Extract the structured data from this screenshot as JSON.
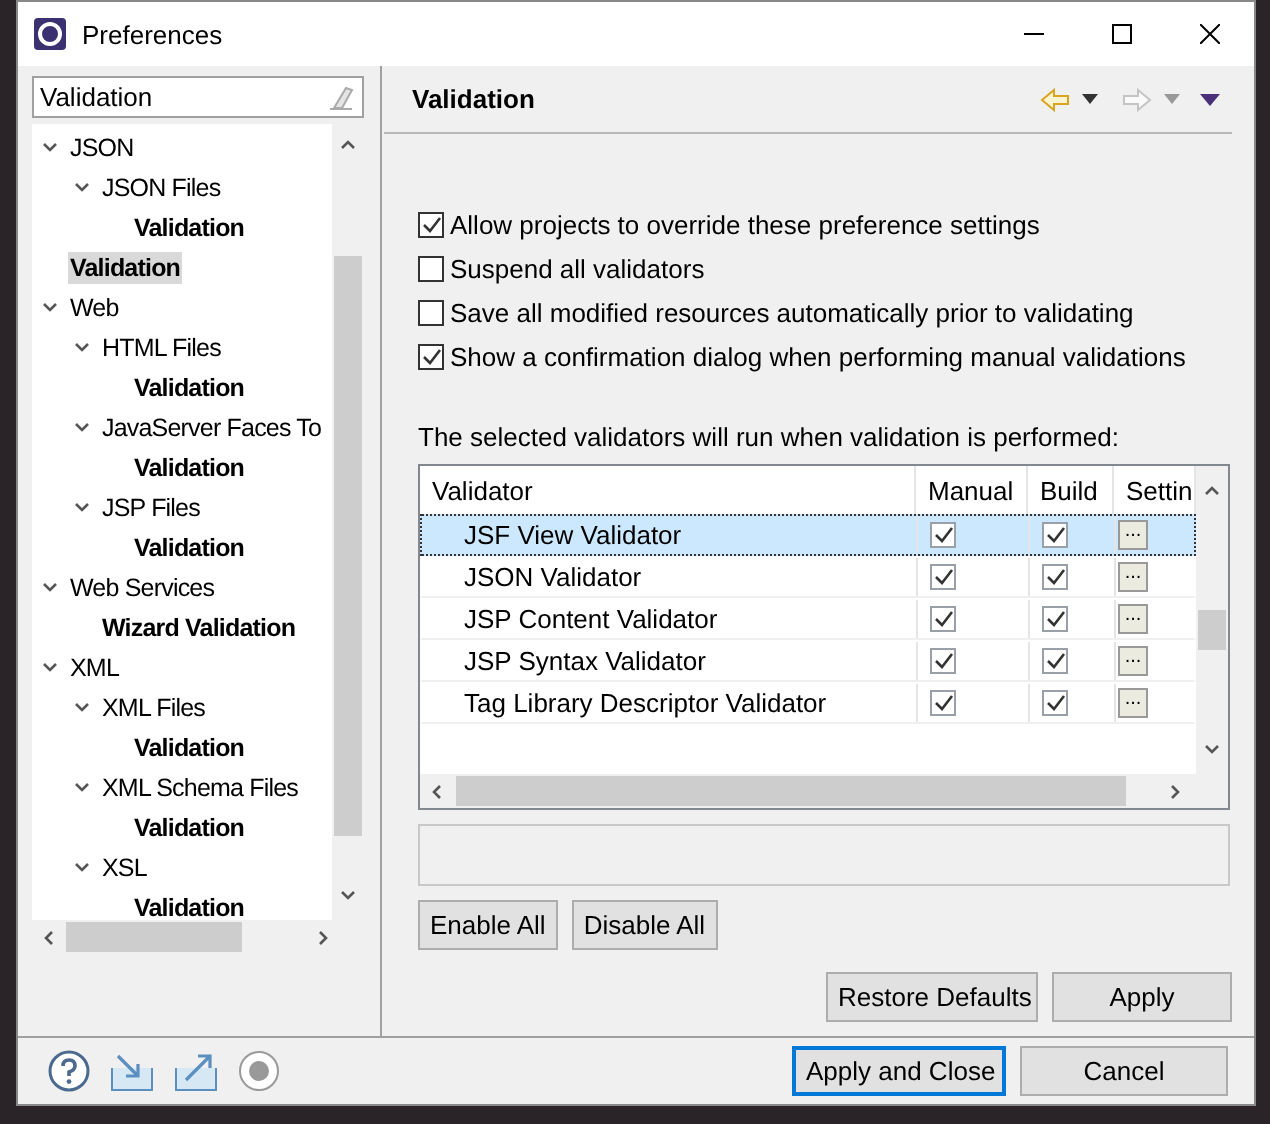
{
  "window": {
    "title": "Preferences"
  },
  "filter": {
    "value": "Validation"
  },
  "tree": [
    {
      "label": "JSON",
      "expanded": true,
      "selected": false,
      "children": [
        {
          "label": "JSON Files",
          "expanded": true,
          "selected": false,
          "children": [
            {
              "label": "Validation",
              "selected": false
            }
          ]
        }
      ]
    },
    {
      "label": "Validation",
      "selected": true
    },
    {
      "label": "Web",
      "expanded": true,
      "selected": false,
      "children": [
        {
          "label": "HTML Files",
          "expanded": true,
          "selected": false,
          "children": [
            {
              "label": "Validation",
              "selected": false
            }
          ]
        },
        {
          "label": "JavaServer Faces To",
          "expanded": true,
          "selected": false,
          "children": [
            {
              "label": "Validation",
              "selected": false
            }
          ]
        },
        {
          "label": "JSP Files",
          "expanded": true,
          "selected": false,
          "children": [
            {
              "label": "Validation",
              "selected": false
            }
          ]
        }
      ]
    },
    {
      "label": "Web Services",
      "expanded": true,
      "selected": false,
      "children": [
        {
          "label": "Wizard Validation",
          "selected": false
        }
      ]
    },
    {
      "label": "XML",
      "expanded": true,
      "selected": false,
      "children": [
        {
          "label": "XML Files",
          "expanded": true,
          "selected": false,
          "children": [
            {
              "label": "Validation",
              "selected": false
            }
          ]
        },
        {
          "label": "XML Schema Files",
          "expanded": true,
          "selected": false,
          "children": [
            {
              "label": "Validation",
              "selected": false
            }
          ]
        },
        {
          "label": "XSL",
          "expanded": true,
          "selected": false,
          "children": [
            {
              "label": "Validation",
              "selected": false
            }
          ]
        }
      ]
    }
  ],
  "page": {
    "title": "Validation"
  },
  "options": [
    {
      "label": "Allow projects to override these preference settings",
      "checked": true
    },
    {
      "label": "Suspend all validators",
      "checked": false
    },
    {
      "label": "Save all modified resources automatically prior to validating",
      "checked": false
    },
    {
      "label": "Show a confirmation dialog when performing manual validations",
      "checked": true
    }
  ],
  "table_caption": "The selected validators will run when validation is performed:",
  "table": {
    "columns": [
      "Validator",
      "Manual",
      "Build",
      "Settin"
    ],
    "rows": [
      {
        "name": "JSF View Validator",
        "manual": true,
        "build": true,
        "settings": "...",
        "selected": true
      },
      {
        "name": "JSON Validator",
        "manual": true,
        "build": true,
        "settings": "...",
        "selected": false
      },
      {
        "name": "JSP Content Validator",
        "manual": true,
        "build": true,
        "settings": "...",
        "selected": false
      },
      {
        "name": "JSP Syntax Validator",
        "manual": true,
        "build": true,
        "settings": "...",
        "selected": false
      },
      {
        "name": "Tag Library Descriptor Validator",
        "manual": true,
        "build": true,
        "settings": "...",
        "selected": false
      }
    ]
  },
  "table_buttons": [
    "Enable All",
    "Disable All"
  ],
  "page_buttons": [
    "Restore Defaults",
    "Apply"
  ],
  "dialog_buttons": [
    {
      "label": "Apply and Close",
      "default": true
    },
    {
      "label": "Cancel",
      "default": false
    }
  ]
}
